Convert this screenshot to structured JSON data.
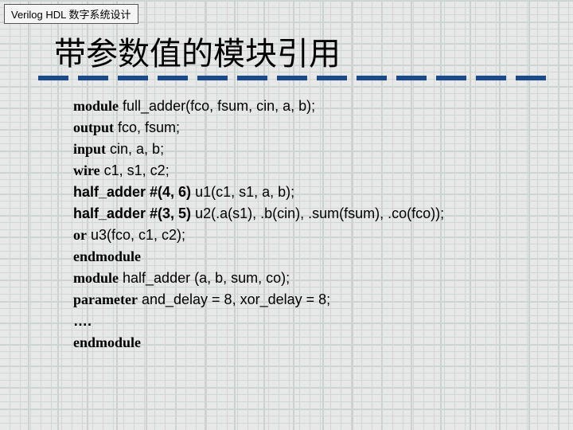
{
  "header": {
    "label": "Verilog HDL 数字系统设计"
  },
  "title": "带参数值的模块引用",
  "code": {
    "lines": [
      {
        "kw": "module",
        "rest": " full_adder(fco, fsum, cin, a, b);"
      },
      {
        "kw": "output",
        "rest": " fco, fsum;"
      },
      {
        "kw": "input",
        "rest": " cin, a, b;"
      },
      {
        "kw": "wire",
        "rest": " c1, s1, c2;"
      },
      {
        "bold": "half_adder #(4, 6)",
        "rest": " u1(c1, s1, a, b);"
      },
      {
        "bold": "half_adder #(3, 5)",
        "rest": " u2(.a(s1), .b(cin), .sum(fsum), .co(fco));"
      },
      {
        "kw": "or",
        "rest": " u3(fco, c1, c2);"
      },
      {
        "kw": "endmodule",
        "rest": ""
      },
      {
        "kw": "module",
        "rest": " half_adder (a, b, sum, co);"
      },
      {
        "kw": "parameter",
        "rest": " and_delay = 8, xor_delay = 8;"
      },
      {
        "bold": "….",
        "rest": ""
      },
      {
        "kw": "endmodule",
        "rest": ""
      }
    ]
  }
}
